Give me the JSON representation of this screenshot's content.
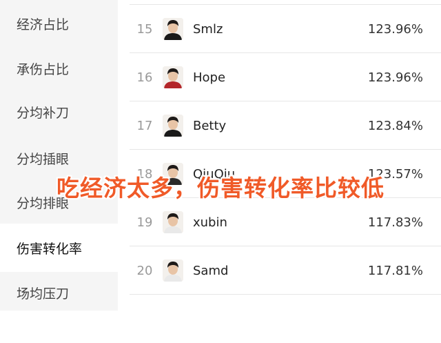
{
  "sidebar": {
    "items": [
      {
        "label": "经济占比"
      },
      {
        "label": "承伤占比"
      },
      {
        "label": "分均补刀"
      },
      {
        "label": "分均插眼"
      },
      {
        "label": "分均排眼"
      },
      {
        "label": "伤害转化率"
      },
      {
        "label": "场均压刀"
      }
    ],
    "active_index": 5
  },
  "ranking": {
    "rows": [
      {
        "rank": "15",
        "name": "Smlz",
        "value": "123.96%",
        "avatar_icon": "player-avatar-icon",
        "jersey": "#1a1a1a"
      },
      {
        "rank": "16",
        "name": "Hope",
        "value": "123.96%",
        "avatar_icon": "player-avatar-icon",
        "jersey": "#b3262a"
      },
      {
        "rank": "17",
        "name": "Betty",
        "value": "123.84%",
        "avatar_icon": "player-avatar-icon",
        "jersey": "#1a1a1a"
      },
      {
        "rank": "18",
        "name": "QiuQiu",
        "value": "123.57%",
        "avatar_icon": "player-avatar-icon",
        "jersey": "#2a2a2a"
      },
      {
        "rank": "19",
        "name": "xubin",
        "value": "117.83%",
        "avatar_icon": "player-avatar-icon",
        "jersey": "#e9e9e9"
      },
      {
        "rank": "20",
        "name": "Samd",
        "value": "117.81%",
        "avatar_icon": "player-avatar-icon",
        "jersey": "#e9e9e9"
      }
    ]
  },
  "overlay": {
    "caption": "吃经济太多，伤害转化率比较低",
    "color": "#f05a28"
  }
}
